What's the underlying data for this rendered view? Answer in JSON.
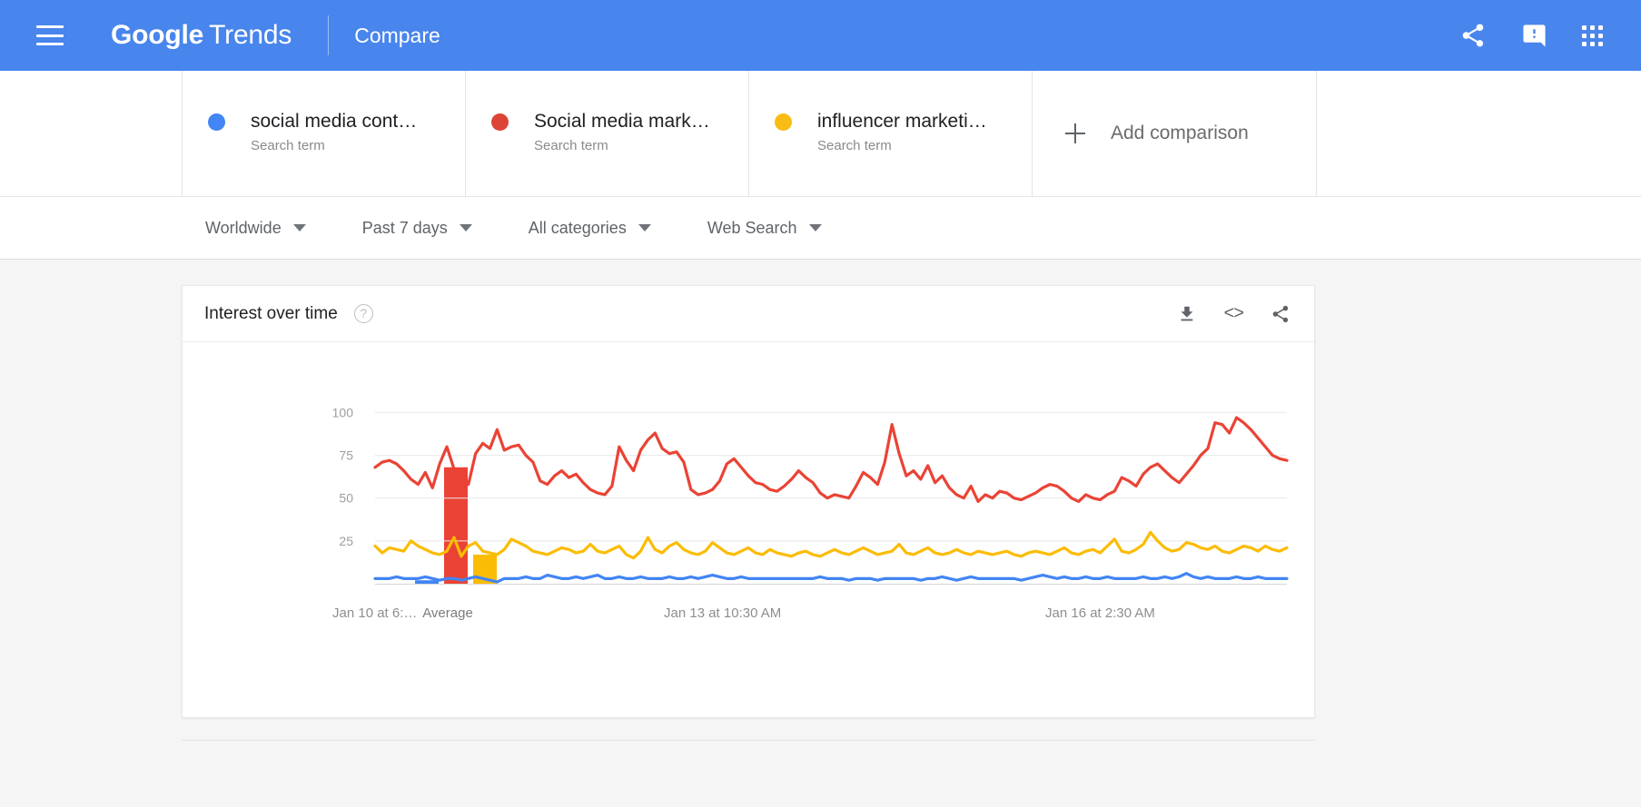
{
  "appbar": {
    "menu_icon": "hamburger-menu-icon",
    "brand_bold": "Google",
    "brand_light": "Trends",
    "section": "Compare",
    "share_icon": "share-icon",
    "feedback_icon": "feedback-icon",
    "apps_icon": "apps-grid-icon"
  },
  "terms": [
    {
      "title": "social media cont…",
      "subtitle": "Search term",
      "color": "#4285f4"
    },
    {
      "title": "Social media mark…",
      "subtitle": "Search term",
      "color": "#db4437"
    },
    {
      "title": "influencer marketi…",
      "subtitle": "Search term",
      "color": "#f9bc15"
    }
  ],
  "add_comparison": {
    "label": "Add comparison",
    "icon": "plus-icon"
  },
  "filters": [
    {
      "label": "Worldwide",
      "name": "location"
    },
    {
      "label": "Past 7 days",
      "name": "time-range"
    },
    {
      "label": "All categories",
      "name": "category"
    },
    {
      "label": "Web Search",
      "name": "search-type"
    }
  ],
  "panel": {
    "title": "Interest over time",
    "help_icon": "help-icon",
    "download_icon": "download-icon",
    "embed_icon": "embed-code-icon",
    "share_icon": "share-icon",
    "embed_glyph": "<>",
    "help_glyph": "?"
  },
  "chart_data": {
    "type": "line",
    "title": "Interest over time",
    "xlabel": "",
    "ylabel": "",
    "ylim": [
      0,
      105
    ],
    "yticks": [
      100,
      75,
      50,
      25
    ],
    "grid": true,
    "legend": "none",
    "xticks": [
      "Jan 10 at 6:…",
      "Jan 13 at 10:30 AM",
      "Jan 16 at 2:30 AM"
    ],
    "average_panel": {
      "label": "Average",
      "values": [
        2,
        68,
        17
      ],
      "colors": [
        "#4285f4",
        "#ea4335",
        "#fbbc05"
      ]
    },
    "series": [
      {
        "name": "social media cont…",
        "color": "#4285f4",
        "values": [
          3,
          3,
          3,
          4,
          3,
          3,
          3,
          4,
          3,
          2,
          3,
          3,
          2,
          3,
          4,
          3,
          2,
          1,
          3,
          3,
          3,
          4,
          3,
          3,
          5,
          4,
          3,
          3,
          4,
          3,
          4,
          5,
          3,
          3,
          4,
          3,
          3,
          4,
          3,
          3,
          3,
          4,
          3,
          3,
          4,
          3,
          4,
          5,
          4,
          3,
          3,
          4,
          3,
          3,
          3,
          3,
          3,
          3,
          3,
          3,
          3,
          3,
          4,
          3,
          3,
          3,
          2,
          3,
          3,
          3,
          2,
          3,
          3,
          3,
          3,
          3,
          2,
          3,
          3,
          4,
          3,
          2,
          3,
          4,
          3,
          3,
          3,
          3,
          3,
          3,
          2,
          3,
          4,
          5,
          4,
          3,
          4,
          3,
          3,
          4,
          3,
          3,
          4,
          3,
          3,
          3,
          3,
          4,
          3,
          3,
          4,
          3,
          4,
          6,
          4,
          3,
          4,
          3,
          3,
          3,
          4,
          3,
          3,
          4,
          3,
          3,
          3,
          3
        ]
      },
      {
        "name": "Social media mark…",
        "color": "#ea4335",
        "values": [
          68,
          71,
          72,
          70,
          66,
          61,
          58,
          65,
          56,
          70,
          80,
          67,
          63,
          58,
          76,
          82,
          79,
          90,
          78,
          80,
          81,
          75,
          71,
          60,
          58,
          63,
          66,
          62,
          64,
          59,
          55,
          53,
          52,
          57,
          80,
          72,
          66,
          78,
          84,
          88,
          79,
          76,
          77,
          71,
          55,
          52,
          53,
          55,
          60,
          70,
          73,
          68,
          63,
          59,
          58,
          55,
          54,
          57,
          61,
          66,
          62,
          59,
          53,
          50,
          52,
          51,
          50,
          57,
          65,
          62,
          58,
          71,
          93,
          76,
          63,
          66,
          61,
          69,
          59,
          63,
          56,
          52,
          50,
          57,
          48,
          52,
          50,
          54,
          53,
          50,
          49,
          51,
          53,
          56,
          58,
          57,
          54,
          50,
          48,
          52,
          50,
          49,
          52,
          54,
          62,
          60,
          57,
          64,
          68,
          70,
          66,
          62,
          59,
          64,
          69,
          75,
          79,
          94,
          93,
          88,
          97,
          94,
          90,
          85,
          80,
          75,
          73,
          72
        ]
      },
      {
        "name": "influencer marketi…",
        "color": "#fbbc05",
        "values": [
          22,
          18,
          21,
          20,
          19,
          25,
          22,
          20,
          18,
          17,
          19,
          27,
          16,
          22,
          24,
          19,
          18,
          17,
          20,
          26,
          24,
          22,
          19,
          18,
          17,
          19,
          21,
          20,
          18,
          19,
          23,
          19,
          18,
          20,
          22,
          17,
          15,
          19,
          27,
          20,
          18,
          22,
          24,
          20,
          18,
          17,
          19,
          24,
          21,
          18,
          17,
          19,
          21,
          18,
          17,
          20,
          18,
          17,
          16,
          18,
          19,
          17,
          16,
          18,
          20,
          18,
          17,
          19,
          21,
          19,
          17,
          18,
          19,
          23,
          18,
          17,
          19,
          21,
          18,
          17,
          18,
          20,
          18,
          17,
          19,
          18,
          17,
          18,
          19,
          17,
          16,
          18,
          19,
          18,
          17,
          19,
          21,
          18,
          17,
          19,
          20,
          18,
          22,
          26,
          19,
          18,
          20,
          23,
          30,
          25,
          21,
          19,
          20,
          24,
          23,
          21,
          20,
          22,
          19,
          18,
          20,
          22,
          21,
          19,
          22,
          20,
          19,
          21
        ]
      }
    ]
  }
}
